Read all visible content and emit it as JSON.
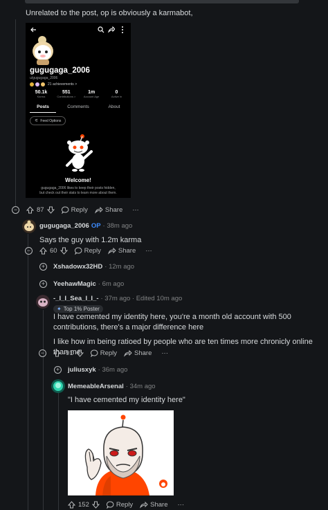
{
  "root_comment": {
    "text": "Unrelated to the post, op is obviously a karmabot,",
    "votes": "87",
    "reply_label": "Reply",
    "share_label": "Share",
    "more": "···"
  },
  "embedded_profile": {
    "username": "gugugaga_2006",
    "handle": "u/gugugaga_2006",
    "achievements": "21 achievements >",
    "stats": [
      {
        "value": "50.1k",
        "label": "Karma"
      },
      {
        "value": "551",
        "label": "Contributions >"
      },
      {
        "value": "1m",
        "label": "Account Age"
      },
      {
        "value": "0",
        "label": "Active in"
      }
    ],
    "tabs": [
      "Posts",
      "Comments",
      "About"
    ],
    "feed_options": "Feed Options",
    "welcome_title": "Welcome!",
    "welcome_text_1": "gugugaga_2006 likes to keep their posts hidden,",
    "welcome_text_2": "but check out their stats to learn more about them."
  },
  "reply_op": {
    "user": "gugugaga_2006",
    "badge": "OP",
    "time": "· 38m ago",
    "text": "Says the guy with 1.2m karma",
    "votes": "60",
    "reply_label": "Reply",
    "share_label": "Share",
    "more": "···"
  },
  "collapsed_1": {
    "user": "Xshadowx32HD",
    "time": "· 12m ago"
  },
  "collapsed_2": {
    "user": "YeehawMagic",
    "time": "· 6m ago"
  },
  "reply_sea": {
    "user": "-_I_I_Sea_I_I_-",
    "time": "· 37m ago · Edited 10m ago",
    "flair": "Top 1% Poster",
    "text_1": "I have cemented my identity here, you're a month old account with 500 contributions, there's a major difference here",
    "text_2": "I like how im being ratioed by people who are ten times more chronicly online than me",
    "votes": "-91",
    "reply_label": "Reply",
    "share_label": "Share",
    "more": "···"
  },
  "collapsed_3": {
    "user": "juliusxyk",
    "time": "· 36m ago"
  },
  "reply_meme": {
    "user": "MemeableArsenal",
    "time": "· 34m ago",
    "text": "\"I have cemented my identity here\"",
    "votes": "152",
    "reply_label": "Reply",
    "share_label": "Share",
    "more": "···"
  },
  "colors": {
    "background": "#141619",
    "text": "#d7dadc",
    "muted": "#818384",
    "op_badge": "#3d8bfd",
    "meme_shirt": "#ff4500"
  }
}
